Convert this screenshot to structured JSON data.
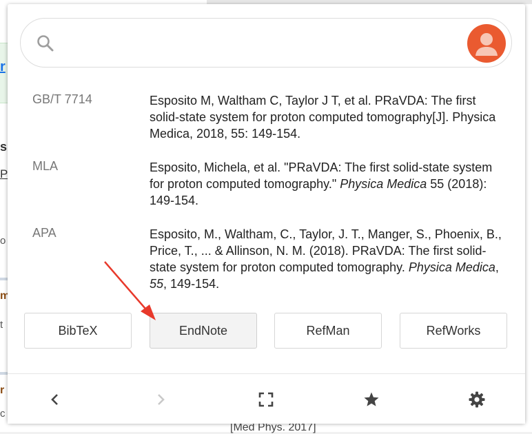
{
  "background": {
    "fragments": [
      "r",
      "s",
      "P",
      "o",
      "m",
      "t",
      "r",
      "c"
    ],
    "footer_text": "[Med Phys. 2017]"
  },
  "search": {
    "placeholder": "",
    "value": ""
  },
  "citations": [
    {
      "style": "GB/T 7714",
      "text": "Esposito M, Waltham C, Taylor J T, et al. PRaVDA: The first solid-state system for proton computed tomography[J]. Physica Medica, 2018, 55: 149-154."
    },
    {
      "style": "MLA",
      "text_before": "Esposito, Michela, et al. \"PRaVDA: The first solid-state system for proton computed tomography.\" ",
      "journal": "Physica Medica",
      "text_after": " 55 (2018): 149-154."
    },
    {
      "style": "APA",
      "text_before": "Esposito, M., Waltham, C., Taylor, J. T., Manger, S., Phoenix, B., Price, T., ... & Allinson, N. M. (2018). PRaVDA: The first solid-state system for proton computed tomography. ",
      "journal": "Physica Medica",
      "sep": ", ",
      "volume": "55",
      "text_after": ", 149-154."
    }
  ],
  "export_buttons": {
    "bibtex": "BibTeX",
    "endnote": "EndNote",
    "refman": "RefMan",
    "refworks": "RefWorks"
  },
  "footer": {
    "icons": [
      "back-icon",
      "forward-icon",
      "fullscreen-icon",
      "star-icon",
      "gear-icon"
    ]
  },
  "colors": {
    "avatar": "#ea5a30",
    "arrow": "#e8392b"
  }
}
